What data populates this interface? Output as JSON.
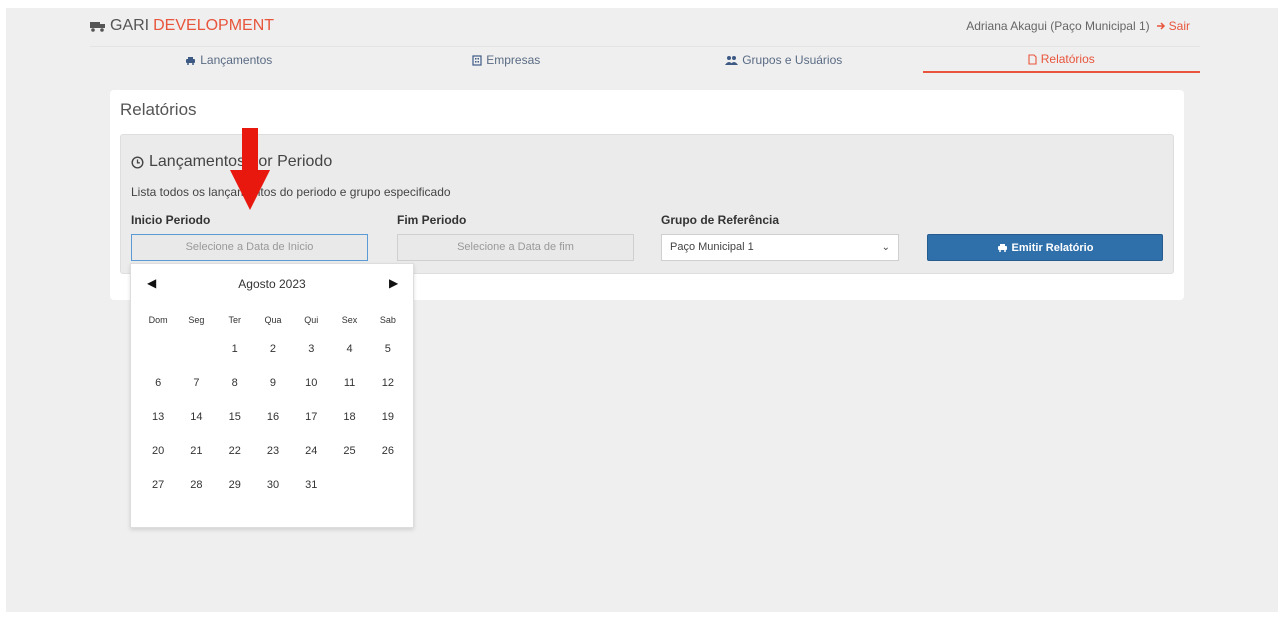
{
  "header": {
    "brand_a": "GARI",
    "brand_b": "DEVELOPMENT",
    "user": "Adriana Akagui (Paço Municipal 1)",
    "logout": "Sair"
  },
  "nav": {
    "tabs": [
      {
        "label": "Lançamentos",
        "icon": "car-icon"
      },
      {
        "label": "Empresas",
        "icon": "building-icon"
      },
      {
        "label": "Grupos e Usuários",
        "icon": "users-icon"
      },
      {
        "label": "Relatórios",
        "icon": "document-icon"
      }
    ]
  },
  "page": {
    "title": "Relatórios",
    "panel_title": "Lançamentos por Periodo",
    "panel_desc": "Lista todos os lançamentos do periodo e grupo especificado",
    "start_label": "Inicio Periodo",
    "end_label": "Fim Periodo",
    "group_label": "Grupo de Referência",
    "start_placeholder": "Selecione a Data de Inicio",
    "end_placeholder": "Selecione a Data de fim",
    "group_value": "Paço Municipal 1",
    "emit_label": "Emitir Relatório"
  },
  "calendar": {
    "month": "Agosto 2023",
    "weekdays": [
      "Dom",
      "Seg",
      "Ter",
      "Qua",
      "Qui",
      "Sex",
      "Sab"
    ],
    "weeks": [
      [
        "",
        "",
        "1",
        "2",
        "3",
        "4",
        "5"
      ],
      [
        "6",
        "7",
        "8",
        "9",
        "10",
        "11",
        "12"
      ],
      [
        "13",
        "14",
        "15",
        "16",
        "17",
        "18",
        "19"
      ],
      [
        "20",
        "21",
        "22",
        "23",
        "24",
        "25",
        "26"
      ],
      [
        "27",
        "28",
        "29",
        "30",
        "31",
        "",
        ""
      ]
    ]
  },
  "colors": {
    "accent": "#e8553c",
    "button": "#2f6faa",
    "arrow": "#e8180f"
  }
}
